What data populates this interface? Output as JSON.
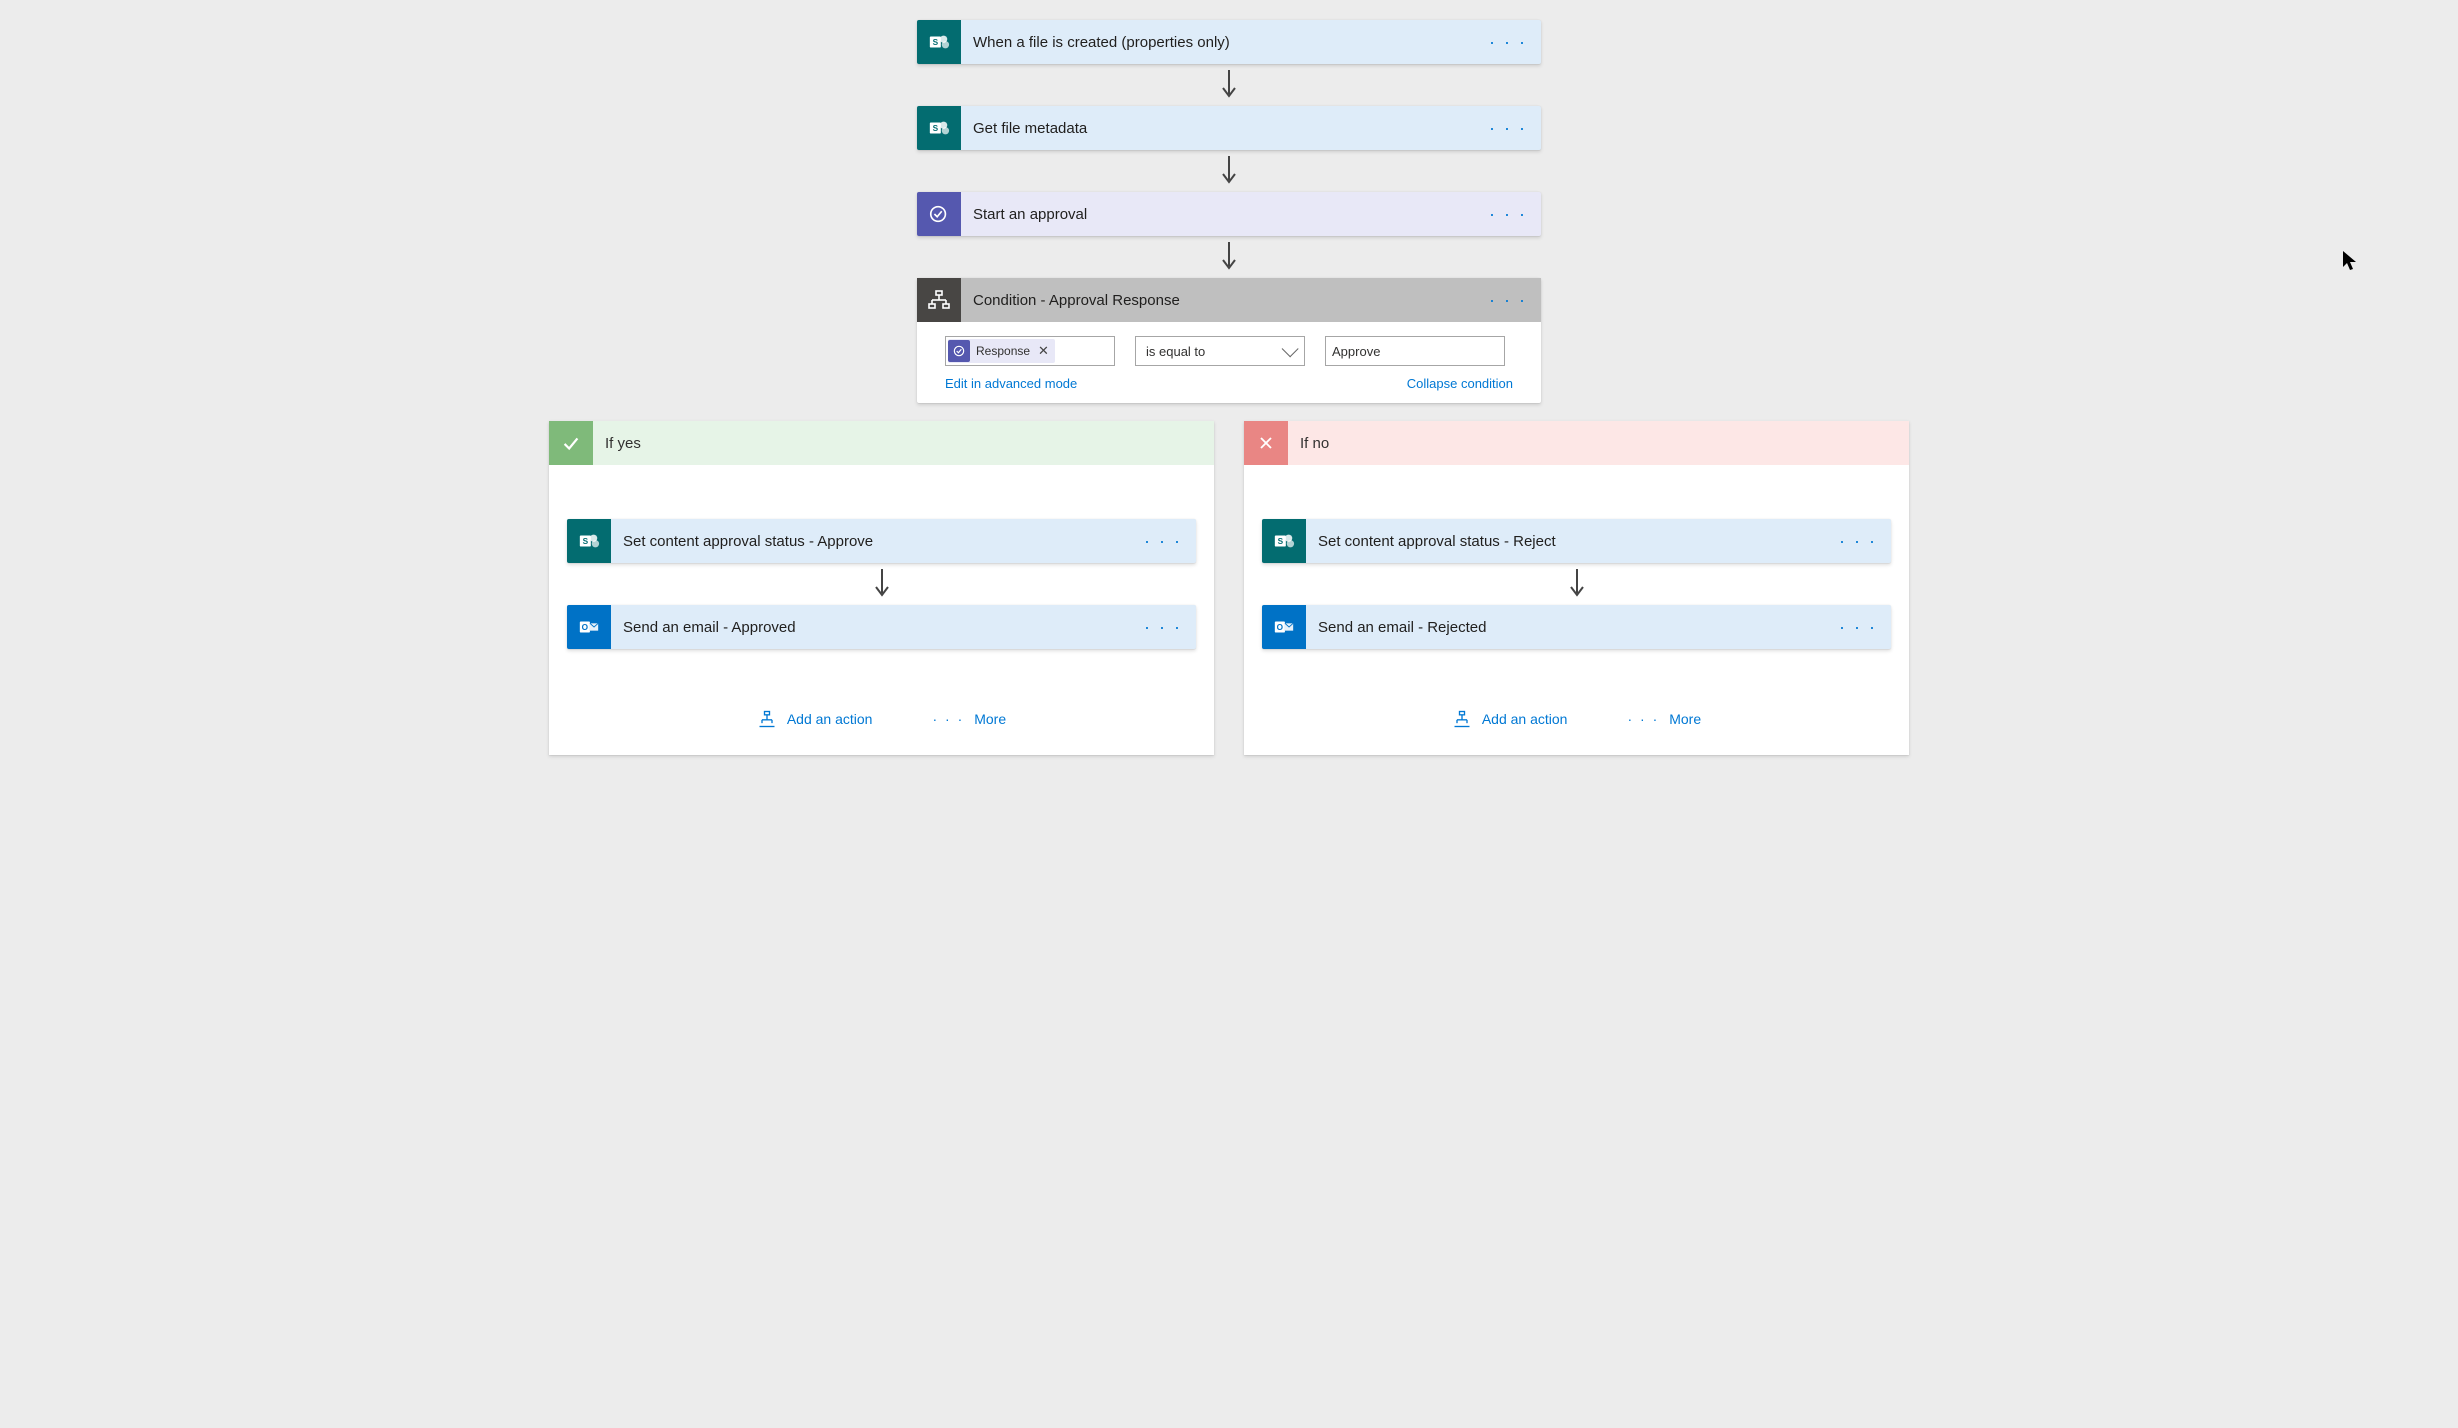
{
  "steps": {
    "trigger": {
      "label": "When a file is created (properties only)"
    },
    "metadata": {
      "label": "Get file metadata"
    },
    "approval": {
      "label": "Start an approval"
    }
  },
  "condition": {
    "title": "Condition - Approval Response",
    "token_label": "Response",
    "operator": "is equal to",
    "value": "Approve",
    "edit_link": "Edit in advanced mode",
    "collapse_link": "Collapse condition"
  },
  "branches": {
    "yes": {
      "title": "If yes",
      "step1": "Set content approval status - Approve",
      "step2": "Send an email - Approved"
    },
    "no": {
      "title": "If no",
      "step1": "Set content approval status - Reject",
      "step2": "Send an email - Rejected"
    }
  },
  "actions": {
    "add": "Add an action",
    "more": "More"
  }
}
